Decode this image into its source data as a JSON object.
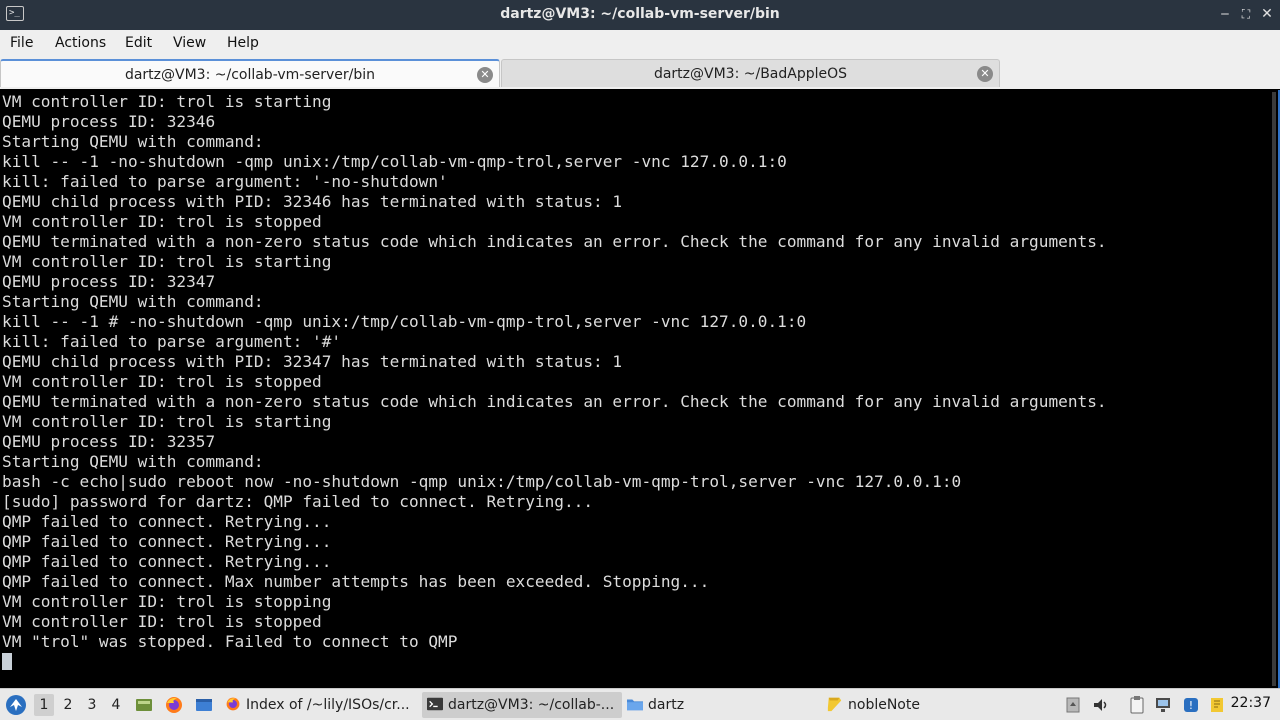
{
  "window": {
    "title": "dartz@VM3: ~/collab-vm-server/bin",
    "app_icon_glyph": ">_",
    "buttons": {
      "minimize": "‒",
      "maximize": "⛶",
      "close": "✕"
    }
  },
  "menu": [
    "File",
    "Actions",
    "Edit",
    "View",
    "Help"
  ],
  "tabs": [
    {
      "label": "dartz@VM3: ~/collab-vm-server/bin",
      "active": true
    },
    {
      "label": "dartz@VM3: ~/BadAppleOS",
      "active": false
    }
  ],
  "terminal": {
    "lines": [
      "VM controller ID: trol is starting",
      "QEMU process ID: 32346",
      "Starting QEMU with command:",
      "kill -- -1 -no-shutdown -qmp unix:/tmp/collab-vm-qmp-trol,server -vnc 127.0.0.1:0",
      "kill: failed to parse argument: '-no-shutdown'",
      "QEMU child process with PID: 32346 has terminated with status: 1",
      "VM controller ID: trol is stopped",
      "QEMU terminated with a non-zero status code which indicates an error. Check the command for any invalid arguments.",
      "VM controller ID: trol is starting",
      "QEMU process ID: 32347",
      "Starting QEMU with command:",
      "kill -- -1 # -no-shutdown -qmp unix:/tmp/collab-vm-qmp-trol,server -vnc 127.0.0.1:0",
      "kill: failed to parse argument: '#'",
      "QEMU child process with PID: 32347 has terminated with status: 1",
      "VM controller ID: trol is stopped",
      "QEMU terminated with a non-zero status code which indicates an error. Check the command for any invalid arguments.",
      "VM controller ID: trol is starting",
      "QEMU process ID: 32357",
      "Starting QEMU with command:",
      "bash -c echo|sudo reboot now -no-shutdown -qmp unix:/tmp/collab-vm-qmp-trol,server -vnc 127.0.0.1:0",
      "[sudo] password for dartz: QMP failed to connect. Retrying...",
      "QMP failed to connect. Retrying...",
      "QMP failed to connect. Retrying...",
      "QMP failed to connect. Retrying...",
      "QMP failed to connect. Max number attempts has been exceeded. Stopping...",
      "VM controller ID: trol is stopping",
      "VM controller ID: trol is stopped",
      "VM \"trol\" was stopped. Failed to connect to QMP"
    ]
  },
  "taskbar": {
    "workspaces": [
      "1",
      "2",
      "3",
      "4"
    ],
    "active_workspace": "1",
    "launchers": [
      "menu-icon",
      "show-desktop-icon",
      "firefox-icon",
      "desktop-icon"
    ],
    "tasks": [
      {
        "label": "Index of /~lily/ISOs/cr...",
        "icon": "firefox-icon",
        "active": false
      },
      {
        "label": "dartz@VM3: ~/collab-...",
        "icon": "terminal-icon",
        "active": true
      },
      {
        "label": "dartz",
        "icon": "folder-icon",
        "active": false
      },
      {
        "label": "nobleNote",
        "icon": "note-icon",
        "active": false
      }
    ],
    "tray": [
      "drive-icon",
      "volume-icon",
      "clipboard-icon",
      "network-icon",
      "updates-icon",
      "notes-icon"
    ],
    "clock": "22:37"
  },
  "colors": {
    "titlebar": "#2a3440",
    "accent": "#2e72c8",
    "terminal_bg": "#000000",
    "terminal_fg": "#dcdcdc"
  }
}
